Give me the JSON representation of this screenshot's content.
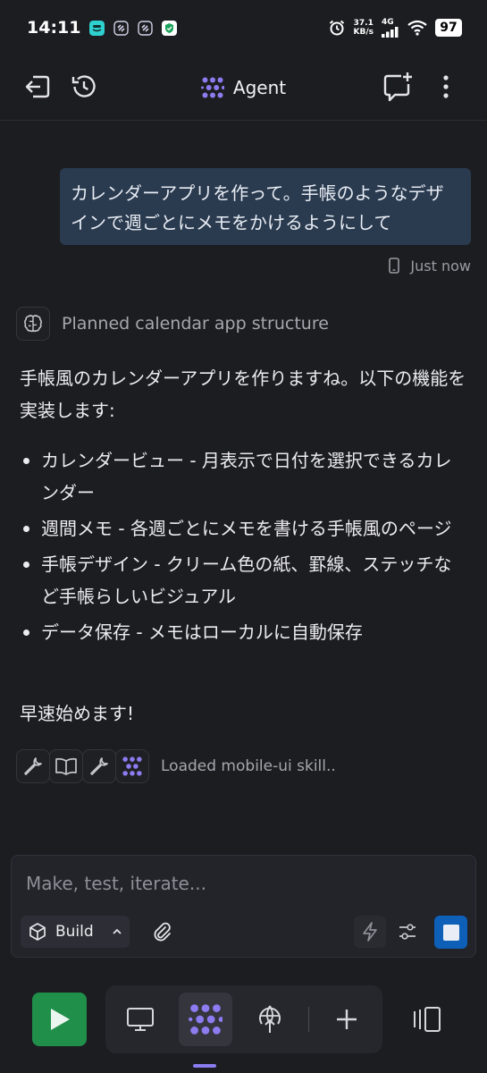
{
  "status_bar": {
    "time": "14:11",
    "net_speed_value": "37.1",
    "net_speed_unit": "KB/s",
    "network_type": "4G",
    "battery": "97"
  },
  "header": {
    "title": "Agent",
    "accent_color": "#8b7cf0"
  },
  "conversation": {
    "user_message": "カレンダーアプリを作って。手帳のようなデザインで週ごとにメモをかけるようにして",
    "user_message_time": "Just now",
    "thought_label": "Planned calendar app structure",
    "assistant_intro": "手帳風のカレンダーアプリを作りますね。以下の機能を実装します:",
    "assistant_items": [
      "カレンダービュー - 月表示で日付を選択できるカレンダー",
      "週間メモ - 各週ごとにメモを書ける手帳風のページ",
      "手帳デザイン - クリーム色の紙、罫線、ステッチなど手帳らしいビジュアル",
      "データ保存 - メモはローカルに自動保存"
    ],
    "assistant_closing": "早速始めます!",
    "tool_status": "Loaded mobile-ui skill.."
  },
  "composer": {
    "placeholder": "Make, test, iterate...",
    "mode_label": "Build",
    "send_color": "#0d5fb8"
  },
  "bottom_nav": {
    "run_color": "#1f8f4a",
    "items": [
      "run-icon",
      "preview-icon",
      "agent-icon",
      "deploy-icon",
      "add-icon",
      "panels-icon"
    ]
  }
}
